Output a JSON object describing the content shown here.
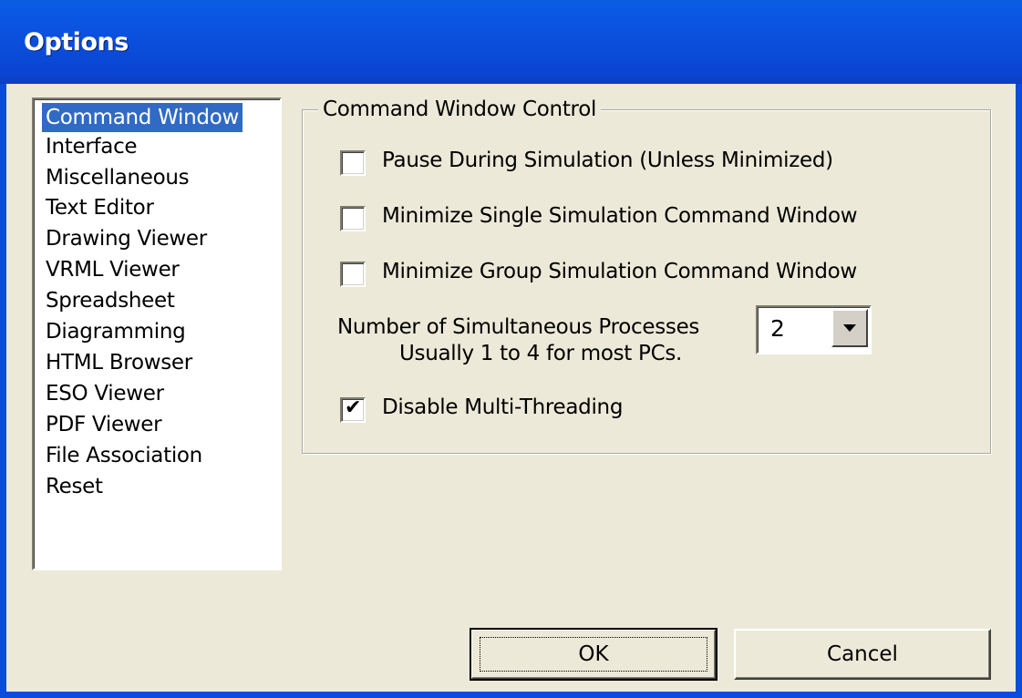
{
  "window": {
    "title": "Options"
  },
  "categories": {
    "selected_index": 0,
    "items": [
      "Command Window",
      "Interface",
      "Miscellaneous",
      "Text Editor",
      "Drawing Viewer",
      "VRML Viewer",
      "Spreadsheet",
      "Diagramming",
      "HTML Browser",
      "ESO Viewer",
      "PDF Viewer",
      "File Association",
      "Reset"
    ]
  },
  "command_window_control": {
    "group_title": "Command Window Control",
    "options": [
      {
        "label": "Pause During Simulation (Unless Minimized)",
        "checked": false
      },
      {
        "label": "Minimize Single Simulation Command Window",
        "checked": false
      },
      {
        "label": "Minimize Group Simulation Command Window",
        "checked": false
      }
    ],
    "processes_label": "Number of Simultaneous Processes",
    "processes_hint": "Usually 1 to 4 for most PCs.",
    "processes_value": "2",
    "multithreading": {
      "label": "Disable Multi-Threading",
      "checked": true
    }
  },
  "buttons": {
    "ok": "OK",
    "cancel": "Cancel"
  },
  "colors": {
    "titlebar": "#0b4ddb",
    "selection": "#316ac5",
    "dialog_bg": "#ece9d8"
  }
}
